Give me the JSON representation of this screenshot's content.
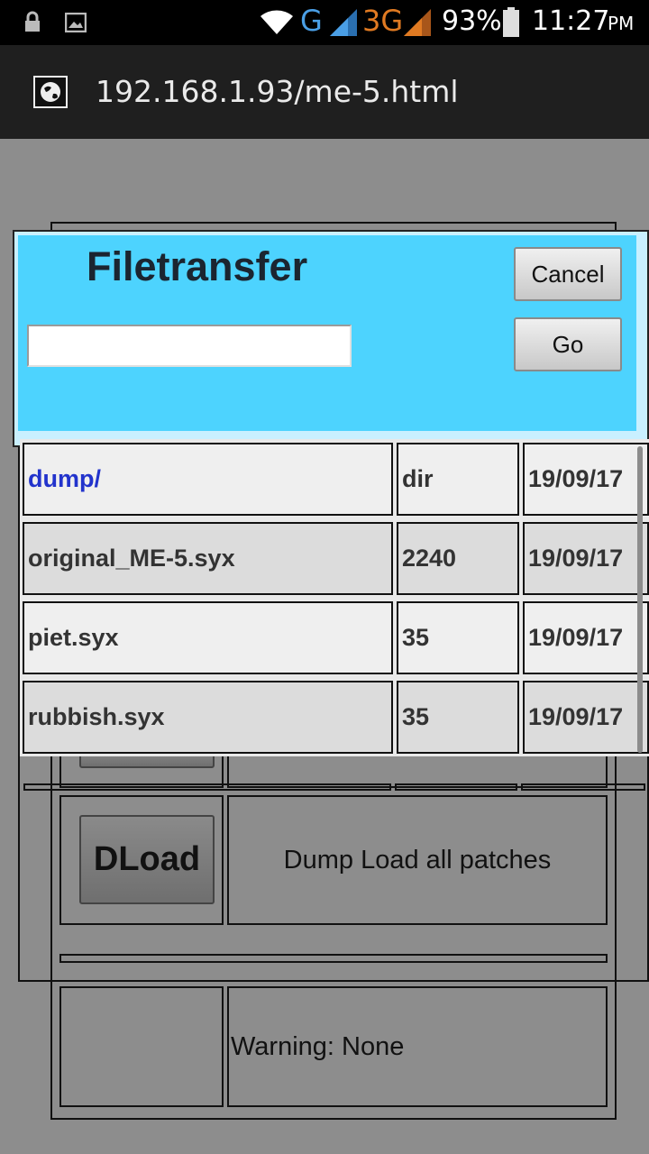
{
  "status_bar": {
    "network_g": "G",
    "network_3g": "3G",
    "battery": "93%",
    "time": "11:27",
    "ampm": "PM"
  },
  "browser": {
    "url": "192.168.1.93/me-5.html"
  },
  "page": {
    "dload_button": "DLoad",
    "dload_description": "Dump Load all patches",
    "warning_text": "Warning: None"
  },
  "dialog": {
    "title": "Filetransfer",
    "input_value": "",
    "cancel_label": "Cancel",
    "go_label": "Go"
  },
  "files": [
    {
      "name": "dump/",
      "size": "dir",
      "date": "19/09/17"
    },
    {
      "name": "original_ME-5.syx",
      "size": "2240",
      "date": "19/09/17"
    },
    {
      "name": "piet.syx",
      "size": "35",
      "date": "19/09/17"
    },
    {
      "name": "rubbish.syx",
      "size": "35",
      "date": "19/09/17"
    }
  ],
  "colors": {
    "dialog_bg": "#4dd3fe",
    "dir_link": "#2233cc"
  }
}
